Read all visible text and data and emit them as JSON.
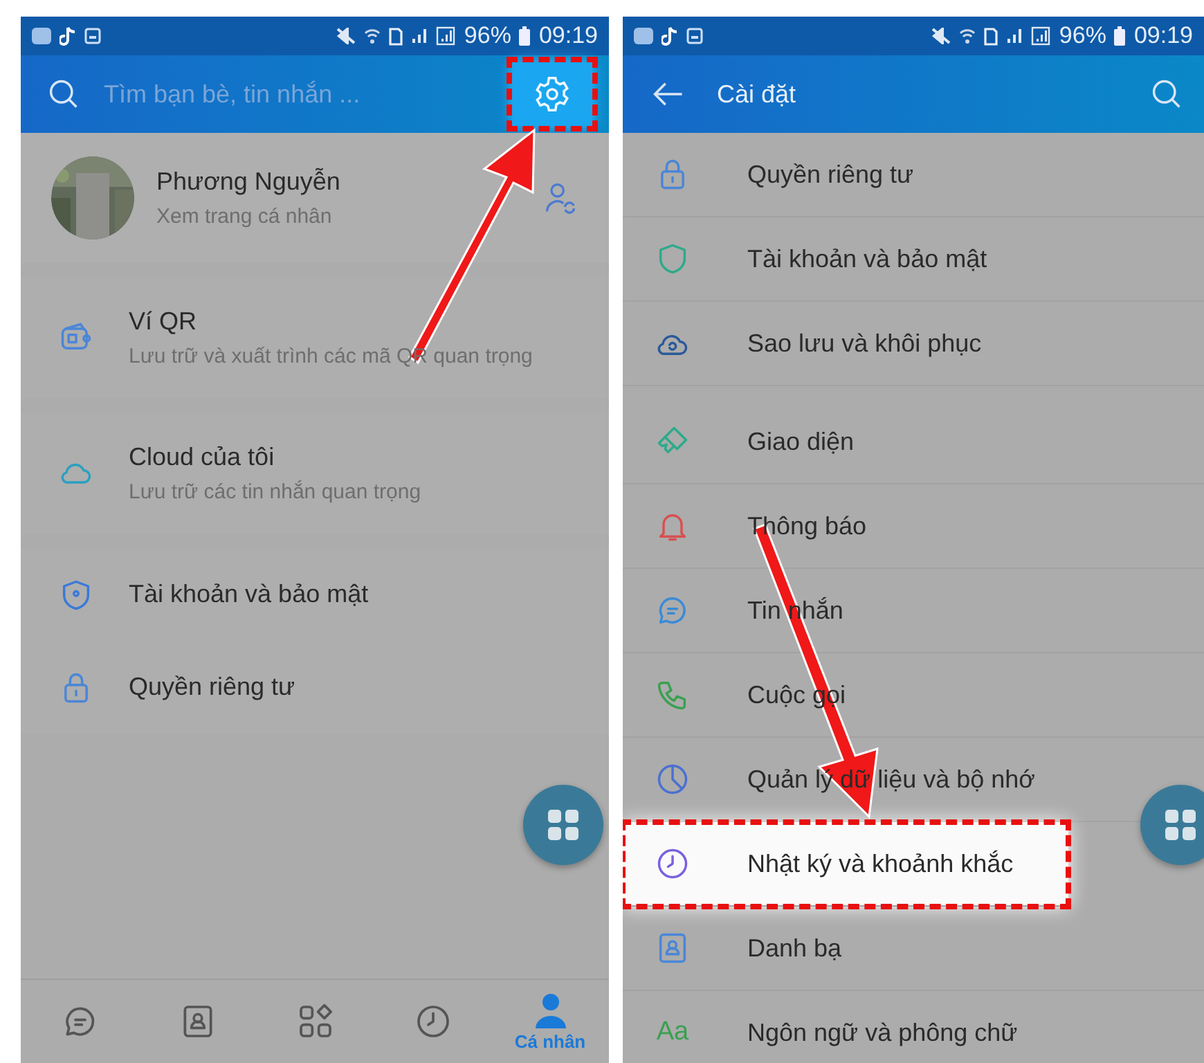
{
  "profile_screen": {
    "status_bar": {
      "battery": "96%",
      "time": "09:19"
    },
    "search": {
      "placeholder": "Tìm bạn bè, tin nhắn ..."
    },
    "settings_button": {
      "highlighted": true
    },
    "profile": {
      "name": "Phương Nguyễn",
      "subtitle": "Xem trang cá nhân"
    },
    "groups": [
      [
        {
          "title": "Ví QR",
          "subtitle": "Lưu trữ và xuất trình các mã QR quan trọng"
        }
      ],
      [
        {
          "title": "Cloud của tôi",
          "subtitle": "Lưu trữ các tin nhắn quan trọng"
        }
      ],
      [
        {
          "title": "Tài khoản và bảo mật"
        },
        {
          "title": "Quyền riêng tư"
        }
      ]
    ],
    "bottom_nav": [
      {
        "selected": false
      },
      {
        "selected": false
      },
      {
        "selected": false
      },
      {
        "selected": false
      },
      {
        "label": "Cá nhân",
        "selected": true
      }
    ]
  },
  "settings_screen": {
    "status_bar": {
      "battery": "96%",
      "time": "09:19"
    },
    "title": "Cài đặt",
    "groups": [
      [
        {
          "label": "Quyền riêng tư",
          "highlighted": false
        },
        {
          "label": "Tài khoản và bảo mật",
          "highlighted": false
        },
        {
          "label": "Sao lưu và khôi phục",
          "highlighted": false
        }
      ],
      [
        {
          "label": "Giao diện",
          "highlighted": false
        },
        {
          "label": "Thông báo",
          "highlighted": false
        },
        {
          "label": "Tin nhắn",
          "highlighted": false
        },
        {
          "label": "Cuộc gọi",
          "highlighted": false
        },
        {
          "label": "Quản lý dữ liệu và bộ nhớ",
          "highlighted": false
        },
        {
          "label": "Nhật ký và khoảnh khắc",
          "highlighted": true
        },
        {
          "label": "Danh bạ",
          "highlighted": false
        },
        {
          "label": "Ngôn ngữ và phông chữ",
          "icon_text": "Aa",
          "highlighted": false
        }
      ]
    ]
  }
}
